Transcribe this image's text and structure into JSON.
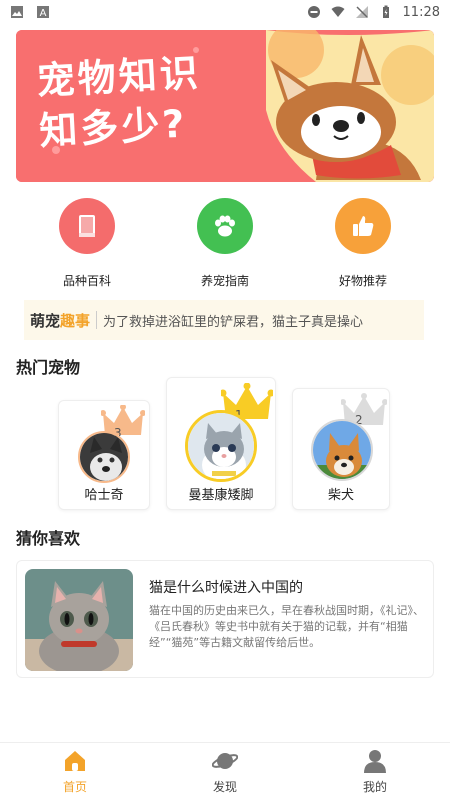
{
  "statusbar": {
    "time": "11:28",
    "icons": [
      "image-icon",
      "a-badge-icon",
      "do-not-disturb-icon",
      "wifi-icon",
      "no-signal-icon",
      "battery-charging-icon"
    ]
  },
  "banner": {
    "line1": "宠物知识",
    "line2": "知多少?",
    "colors": {
      "bg": "#f86f6f",
      "dog_brown": "#c4773c",
      "scarf": "#e24b3b"
    }
  },
  "categories": [
    {
      "label": "品种百科",
      "icon": "book-icon",
      "color": "#f46c6c"
    },
    {
      "label": "养宠指南",
      "icon": "paw-icon",
      "color": "#43c052"
    },
    {
      "label": "好物推荐",
      "icon": "thumbs-up-icon",
      "color": "#f7a13a"
    }
  ],
  "ticker": {
    "tag_part1": "萌宠",
    "tag_part2": "趣事",
    "text": "为了救掉进浴缸里的铲屎君，猫主子真是操心"
  },
  "hot_pets": {
    "title": "热门宠物",
    "items": [
      {
        "rank": "3",
        "name": "哈士奇",
        "crown_color": "#f7b98a"
      },
      {
        "rank": "1",
        "name": "曼基康矮脚",
        "crown_color": "#f8cc25"
      },
      {
        "rank": "2",
        "name": "柴犬",
        "crown_color": "#d8d8d8"
      }
    ]
  },
  "guess": {
    "title": "猜你喜欢",
    "item": {
      "title": "猫是什么时候进入中国的",
      "desc": "猫在中国的历史由来已久，早在春秋战国时期，《礼记》、《吕氏春秋》等史书中就有关于猫的记载，并有“相猫经”“猫苑”等古籍文献留传给后世。"
    }
  },
  "nav": {
    "items": [
      {
        "label": "首页",
        "icon": "home-icon",
        "active": true
      },
      {
        "label": "发现",
        "icon": "planet-icon",
        "active": false
      },
      {
        "label": "我的",
        "icon": "user-icon",
        "active": false
      }
    ],
    "active_color": "#f3a32a"
  }
}
